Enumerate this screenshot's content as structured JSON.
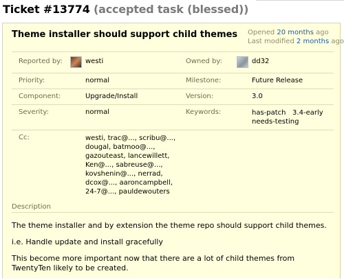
{
  "ticket": {
    "number": "Ticket #13774",
    "status": "(accepted task (blessed))"
  },
  "summary": "Theme installer should support child themes",
  "opened": {
    "prefix": "Opened",
    "link": "20 months",
    "suffix": "ago"
  },
  "modified": {
    "prefix": "Last modified",
    "link": "2 months",
    "suffix": "ago"
  },
  "props": {
    "reported_by": {
      "label": "Reported by:",
      "value": "westi"
    },
    "owned_by": {
      "label": "Owned by:",
      "value": "dd32"
    },
    "priority": {
      "label": "Priority:",
      "value": "normal"
    },
    "milestone": {
      "label": "Milestone:",
      "value": "Future Release"
    },
    "component": {
      "label": "Component:",
      "value": "Upgrade/Install"
    },
    "version": {
      "label": "Version:",
      "value": "3.0"
    },
    "severity": {
      "label": "Severity:",
      "value": "normal"
    },
    "keywords": {
      "label": "Keywords:",
      "line1": "has-patch   3.4-early",
      "line2": "needs-testing"
    },
    "cc": {
      "label": "Cc:",
      "lines": [
        "westi, trac@..., scribu@...,",
        "dougal, batmoo@...,",
        "gazouteast, lancewillett,",
        "Ken@..., sabreuse@...,",
        "kovshenin@..., nerrad,",
        "dcox@..., aaroncampbell,",
        "24-7@..., pauldewouters"
      ]
    }
  },
  "description": {
    "heading": "Description",
    "paragraphs": [
      "The theme installer and by extension the theme repo should support child themes.",
      "i.e. Handle update and install gracefully",
      "This become more important now that there are a lot of child themes from TwentyTen likely to be created."
    ]
  }
}
